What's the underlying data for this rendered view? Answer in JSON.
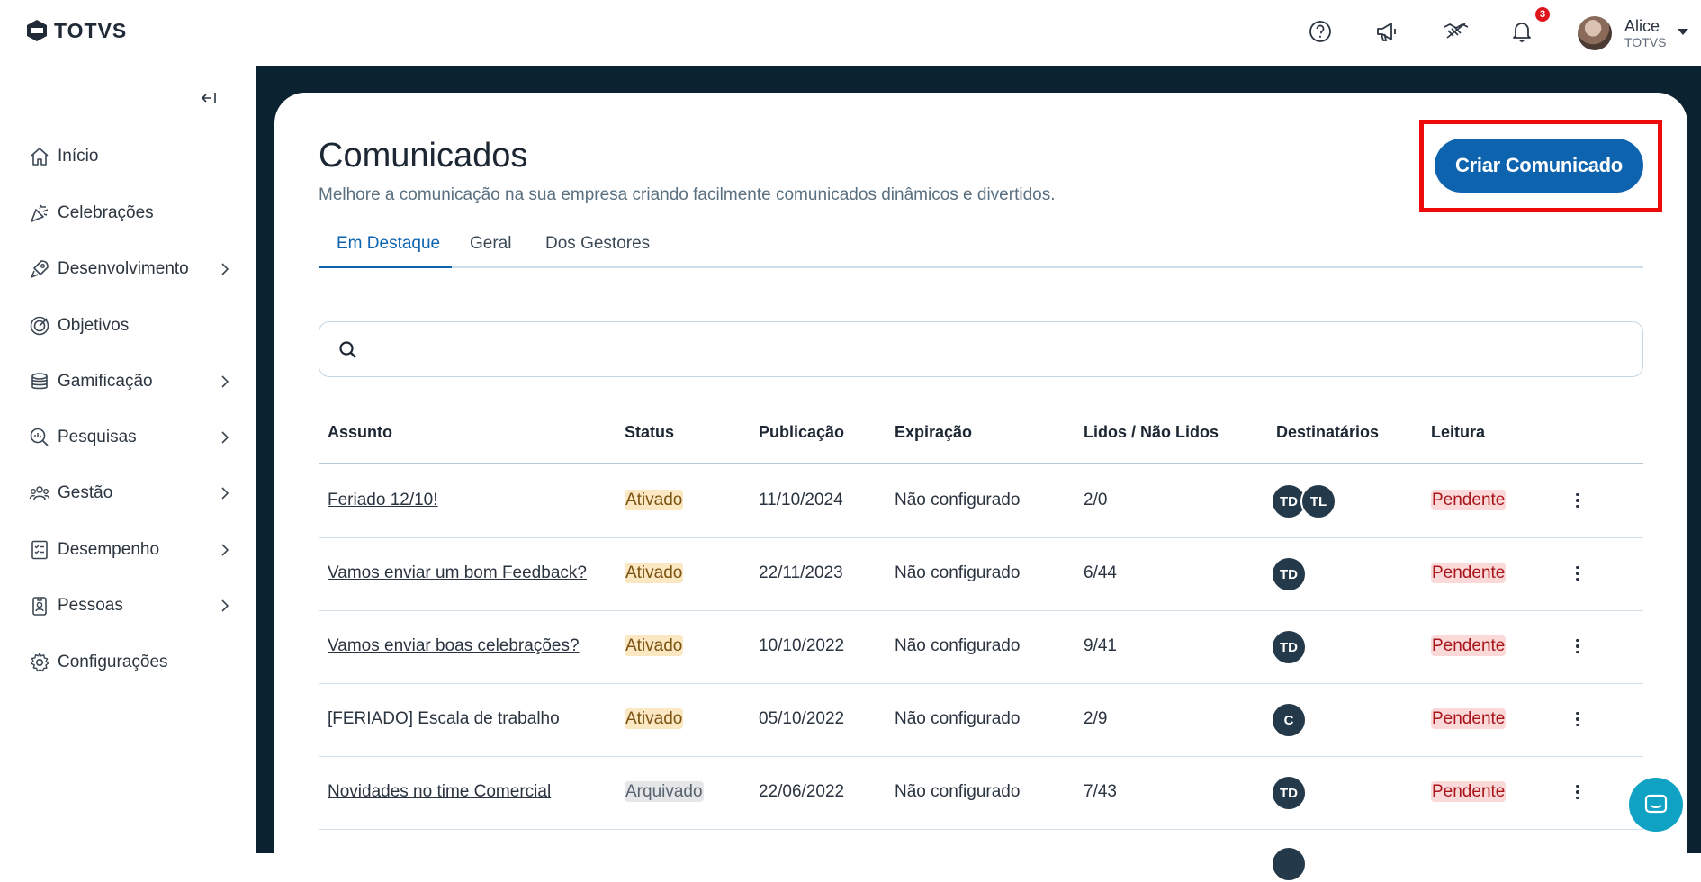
{
  "header": {
    "logo_text": "TOTVS",
    "notification_count": "3",
    "user": {
      "name": "Alice",
      "org": "TOTVS"
    },
    "icons": [
      "help-icon",
      "megaphone-icon",
      "handshake-icon",
      "bell-icon"
    ]
  },
  "sidebar": {
    "items": [
      {
        "label": "Início",
        "icon": "home-icon",
        "has_children": false
      },
      {
        "label": "Celebrações",
        "icon": "party-popper-icon",
        "has_children": false
      },
      {
        "label": "Desenvolvimento",
        "icon": "rocket-icon",
        "has_children": true
      },
      {
        "label": "Objetivos",
        "icon": "target-icon",
        "has_children": false
      },
      {
        "label": "Gamificação",
        "icon": "coins-icon",
        "has_children": true
      },
      {
        "label": "Pesquisas",
        "icon": "search-chart-icon",
        "has_children": true
      },
      {
        "label": "Gestão",
        "icon": "people-icon",
        "has_children": true
      },
      {
        "label": "Desempenho",
        "icon": "checklist-icon",
        "has_children": true
      },
      {
        "label": "Pessoas",
        "icon": "badge-icon",
        "has_children": true
      },
      {
        "label": "Configurações",
        "icon": "gear-icon",
        "has_children": false
      }
    ]
  },
  "main": {
    "title": "Comunicados",
    "subtitle": "Melhore a comunicação na sua empresa criando facilmente comunicados dinâmicos e divertidos.",
    "create_button": "Criar Comunicado",
    "tabs": [
      {
        "label": "Em Destaque",
        "active": true
      },
      {
        "label": "Geral",
        "active": false
      },
      {
        "label": "Dos Gestores",
        "active": false
      }
    ],
    "search": {
      "placeholder": "",
      "value": ""
    },
    "table": {
      "columns": [
        "Assunto",
        "Status",
        "Publicação",
        "Expiração",
        "Lidos / Não Lidos",
        "Destinatários",
        "Leitura"
      ],
      "rows": [
        {
          "subject": "Feriado 12/10!",
          "status": "Ativado",
          "published": "11/10/2024",
          "expiration": "Não configurado",
          "read": "2/0",
          "recipients": [
            "TD",
            "TL"
          ],
          "reading": "Pendente"
        },
        {
          "subject": "Vamos enviar um bom Feedback?",
          "status": "Ativado",
          "published": "22/11/2023",
          "expiration": "Não configurado",
          "read": "6/44",
          "recipients": [
            "TD"
          ],
          "reading": "Pendente"
        },
        {
          "subject": "Vamos enviar boas celebrações?",
          "status": "Ativado",
          "published": "10/10/2022",
          "expiration": "Não configurado",
          "read": "9/41",
          "recipients": [
            "TD"
          ],
          "reading": "Pendente"
        },
        {
          "subject": "[FERIADO] Escala de trabalho",
          "status": "Ativado",
          "published": "05/10/2022",
          "expiration": "Não configurado",
          "read": "2/9",
          "recipients": [
            "C"
          ],
          "reading": "Pendente"
        },
        {
          "subject": "Novidades no time Comercial",
          "status": "Arquivado",
          "published": "22/06/2022",
          "expiration": "Não configurado",
          "read": "7/43",
          "recipients": [
            "TD"
          ],
          "reading": "Pendente"
        }
      ]
    }
  },
  "colors": {
    "brand": "#0d63ae",
    "frame": "#0b2231",
    "highlight": "#ee0b0b",
    "ativado_bg": "#fbe7c2",
    "pendente_bg": "#fbd9d9"
  }
}
